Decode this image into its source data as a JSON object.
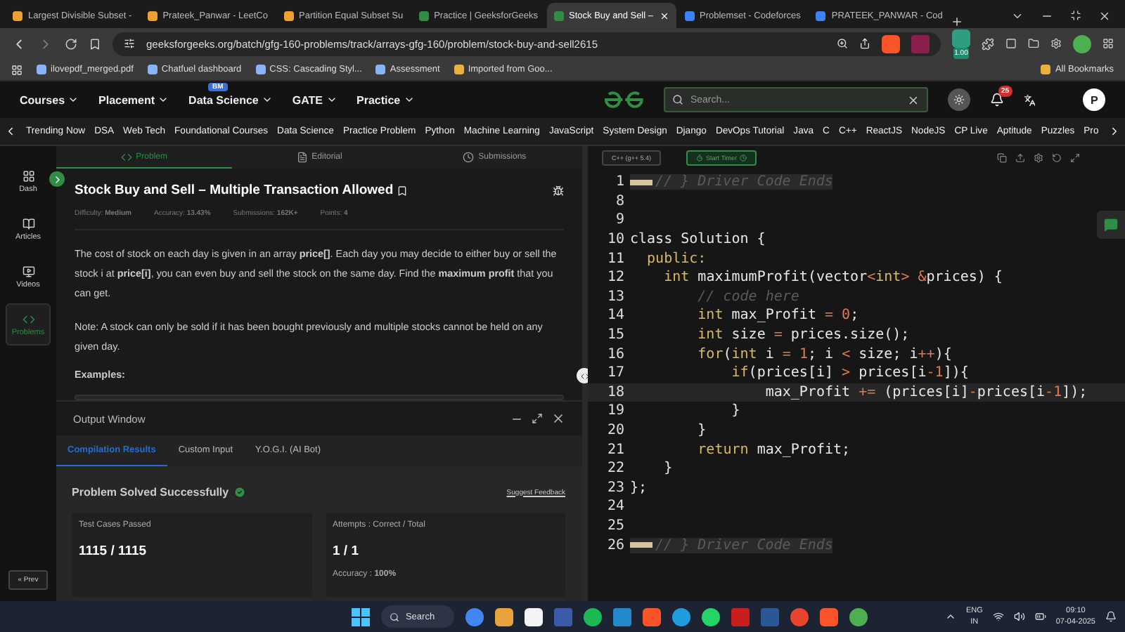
{
  "browser": {
    "tabs": [
      {
        "title": "Largest Divisible Subset -",
        "selected": false,
        "color": "#f0a030"
      },
      {
        "title": "Prateek_Panwar - LeetCo",
        "selected": false,
        "color": "#f0a030"
      },
      {
        "title": "Partition Equal Subset Su",
        "selected": false,
        "color": "#f0a030"
      },
      {
        "title": "Practice | GeeksforGeeks",
        "selected": false,
        "color": "#2f8d46"
      },
      {
        "title": "Stock Buy and Sell – ",
        "selected": true,
        "color": "#2f8d46"
      },
      {
        "title": "Problemset - Codeforces",
        "selected": false,
        "color": "#3b82f6"
      },
      {
        "title": "PRATEEK_PANWAR - Cod",
        "selected": false,
        "color": "#3b82f6"
      }
    ],
    "url": "geeksforgeeks.org/batch/gfg-160-problems/track/arrays-gfg-160/problem/stock-buy-and-sell2615",
    "extension_badge": "1.00",
    "bookmarks": [
      "ilovepdf_merged.pdf",
      "Chatfuel dashboard",
      "CSS: Cascading Styl...",
      "Assessment",
      "Imported from Goo..."
    ],
    "all_bookmarks": "All Bookmarks"
  },
  "site_nav": {
    "menus": [
      {
        "label": "Courses"
      },
      {
        "label": "Placement"
      },
      {
        "label": "Data Science",
        "badge": "BM"
      },
      {
        "label": "GATE"
      },
      {
        "label": "Practice"
      }
    ],
    "search": {
      "placeholder": "Search..."
    },
    "notifications": "25",
    "avatar": "P"
  },
  "categories": [
    "Trending Now",
    "DSA",
    "Web Tech",
    "Foundational Courses",
    "Data Science",
    "Practice Problem",
    "Python",
    "Machine Learning",
    "JavaScript",
    "System Design",
    "Django",
    "DevOps Tutorial",
    "Java",
    "C",
    "C++",
    "ReactJS",
    "NodeJS",
    "CP Live",
    "Aptitude",
    "Puzzles",
    "Pro"
  ],
  "sidebar": {
    "items": [
      {
        "label": "Dash",
        "kind": "dash",
        "selected": false
      },
      {
        "label": "Articles",
        "kind": "articles",
        "selected": false
      },
      {
        "label": "Videos",
        "kind": "videos",
        "selected": false
      },
      {
        "label": "Problems",
        "kind": "problems",
        "selected": true
      }
    ],
    "prev": "« Prev"
  },
  "problem": {
    "tabs": [
      {
        "label": "Problem",
        "kind": "code",
        "selected": true
      },
      {
        "label": "Editorial",
        "kind": "doc",
        "selected": false
      },
      {
        "label": "Submissions",
        "kind": "clock",
        "selected": false
      }
    ],
    "title": "Stock Buy and Sell – Multiple Transaction Allowed",
    "meta": [
      "Difficulty: **Medium**",
      "Accuracy: **13.43%**",
      "Submissions: **162K+**",
      "Points: **4**"
    ],
    "paragraphs": [
      "The cost of stock on each day is given in an array **price[]**. Each day you may decide to either buy or sell the stock i at **price[i]**, you can even buy and sell the stock on the same day. Find the **maximum profit** that you can get.",
      "Note: A stock can only be sold if it has been bought previously and multiple stocks cannot be held on any given day."
    ],
    "examples_heading": "Examples:"
  },
  "output_window": {
    "title": "Output Window",
    "tabs": [
      {
        "label": "Compilation Results",
        "selected": true
      },
      {
        "label": "Custom Input",
        "selected": false
      },
      {
        "label": "Y.O.G.I. (AI Bot)",
        "selected": false
      }
    ],
    "status": "Problem Solved Successfully",
    "feedback": "Suggest Feedback",
    "cards": [
      {
        "label": "Test Cases Passed",
        "value": "1115 / 1115"
      },
      {
        "label": "Attempts : Correct / Total",
        "value": "1 / 1",
        "note": "Accuracy : **100%**"
      }
    ]
  },
  "editor": {
    "language": "C++ (g++ 5.4)",
    "timer": "Start Timer",
    "lines": [
      {
        "number": "1",
        "kind": "fold",
        "tokens": [
          {
            "kind": "comment",
            "text": "// } Driver Code Ends"
          }
        ]
      },
      {
        "number": "8",
        "kind": "code"
      },
      {
        "number": "9",
        "kind": "code"
      },
      {
        "number": "10",
        "kind": "code",
        "tokens": [
          {
            "kind": "plain",
            "text": "class Solution {"
          }
        ]
      },
      {
        "number": "11",
        "kind": "code",
        "tokens": [
          {
            "kind": "keyword",
            "text": "  public:"
          }
        ]
      },
      {
        "number": "12",
        "kind": "code",
        "tokens": [
          {
            "kind": "keyword",
            "text": "    int"
          },
          {
            "kind": "plain",
            "text": " maximumProfit(vector"
          },
          {
            "kind": "operator",
            "text": "<"
          },
          {
            "kind": "keyword",
            "text": "int"
          },
          {
            "kind": "operator",
            "text": ">"
          },
          {
            "kind": "operator",
            "text": " &"
          },
          {
            "kind": "plain",
            "text": "prices) {"
          }
        ]
      },
      {
        "number": "13",
        "kind": "code",
        "tokens": [
          {
            "kind": "comment",
            "text": "        // code here"
          }
        ]
      },
      {
        "number": "14",
        "kind": "code",
        "tokens": [
          {
            "kind": "keyword",
            "text": "        int"
          },
          {
            "kind": "plain",
            "text": " max_Profit "
          },
          {
            "kind": "operator",
            "text": "="
          },
          {
            "kind": "number",
            "text": " 0"
          },
          {
            "kind": "plain",
            "text": ";"
          }
        ]
      },
      {
        "number": "15",
        "kind": "code",
        "tokens": [
          {
            "kind": "keyword",
            "text": "        int"
          },
          {
            "kind": "plain",
            "text": " size "
          },
          {
            "kind": "operator",
            "text": "="
          },
          {
            "kind": "plain",
            "text": " prices.size();"
          }
        ]
      },
      {
        "number": "16",
        "kind": "code",
        "tokens": [
          {
            "kind": "keyword",
            "text": "        for"
          },
          {
            "kind": "plain",
            "text": "("
          },
          {
            "kind": "keyword",
            "text": "int"
          },
          {
            "kind": "plain",
            "text": " i "
          },
          {
            "kind": "operator",
            "text": "="
          },
          {
            "kind": "number",
            "text": " 1"
          },
          {
            "kind": "plain",
            "text": "; i "
          },
          {
            "kind": "operator",
            "text": "<"
          },
          {
            "kind": "plain",
            "text": " size; i"
          },
          {
            "kind": "operator",
            "text": "++"
          },
          {
            "kind": "plain",
            "text": "){"
          }
        ]
      },
      {
        "number": "17",
        "kind": "code",
        "tokens": [
          {
            "kind": "keyword",
            "text": "            if"
          },
          {
            "kind": "plain",
            "text": "(prices[i] "
          },
          {
            "kind": "operator",
            "text": ">"
          },
          {
            "kind": "plain",
            "text": " prices[i"
          },
          {
            "kind": "operator",
            "text": "-"
          },
          {
            "kind": "number",
            "text": "1"
          },
          {
            "kind": "plain",
            "text": "]){"
          }
        ]
      },
      {
        "number": "18",
        "kind": "code",
        "active": true,
        "tokens": [
          {
            "kind": "plain",
            "text": "                max_Profit "
          },
          {
            "kind": "operator",
            "text": "+="
          },
          {
            "kind": "plain",
            "text": " (prices[i]"
          },
          {
            "kind": "operator",
            "text": "-"
          },
          {
            "kind": "plain",
            "text": "prices[i"
          },
          {
            "kind": "operator",
            "text": "-"
          },
          {
            "kind": "number",
            "text": "1"
          },
          {
            "kind": "plain",
            "text": "]);"
          }
        ]
      },
      {
        "number": "19",
        "kind": "code",
        "tokens": [
          {
            "kind": "plain",
            "text": "            }"
          }
        ]
      },
      {
        "number": "20",
        "kind": "code",
        "tokens": [
          {
            "kind": "plain",
            "text": "        }"
          }
        ]
      },
      {
        "number": "21",
        "kind": "code",
        "tokens": [
          {
            "kind": "keyword",
            "text": "        return"
          },
          {
            "kind": "plain",
            "text": " max_Profit;"
          }
        ]
      },
      {
        "number": "22",
        "kind": "code",
        "tokens": [
          {
            "kind": "plain",
            "text": "    }"
          }
        ]
      },
      {
        "number": "23",
        "kind": "code",
        "tokens": [
          {
            "kind": "plain",
            "text": "};"
          }
        ]
      },
      {
        "number": "24",
        "kind": "code"
      },
      {
        "number": "25",
        "kind": "code"
      },
      {
        "number": "26",
        "kind": "fold",
        "tokens": [
          {
            "kind": "comment",
            "text": "// } Driver Code Ends"
          }
        ]
      }
    ]
  },
  "taskbar": {
    "search": "Search",
    "language": "ENG",
    "region": "IN",
    "time": "09:10",
    "date": "07-04-2025"
  }
}
